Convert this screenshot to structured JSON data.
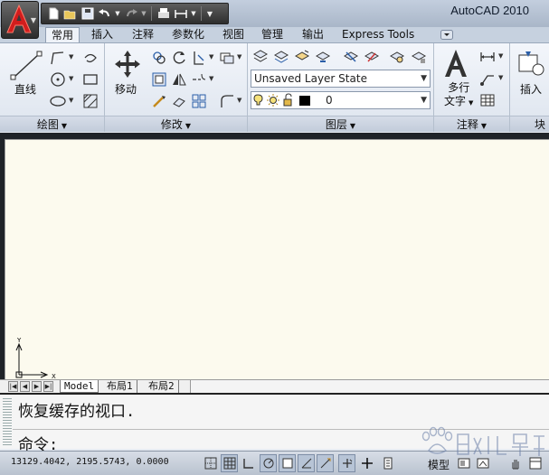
{
  "app": {
    "title": "AutoCAD 2010",
    "menu_button_icon": "autocad-logo-icon"
  },
  "quick_access_toolbar": [
    {
      "name": "qnew-icon"
    },
    {
      "name": "open-icon"
    },
    {
      "name": "save-icon"
    },
    {
      "name": "undo-icon"
    },
    {
      "name": "redo-icon"
    },
    {
      "name": "plot-icon"
    },
    {
      "name": "match-props-icon"
    }
  ],
  "ribbon": {
    "tabs": [
      "常用",
      "插入",
      "注释",
      "参数化",
      "视图",
      "管理",
      "输出",
      "Express Tools"
    ],
    "active_tab": "常用",
    "panels": {
      "draw": {
        "title": "绘图",
        "big_label": "直线"
      },
      "modify": {
        "title": "修改",
        "big_label": "移动"
      },
      "layers": {
        "title": "图层",
        "layer_state": "Unsaved Layer State",
        "current_layer": "0",
        "layer_color": "#000000"
      },
      "annotation": {
        "title": "注释",
        "big_label_line1": "多行",
        "big_label_line2": "文字"
      },
      "block": {
        "title": "块",
        "big_label": "插入"
      }
    }
  },
  "drawing": {
    "background": "#fcfaee",
    "ucs_x_label": "X",
    "ucs_y_label": "Y"
  },
  "layout_tabs": [
    "Model",
    "布局1",
    "布局2"
  ],
  "command_window": {
    "history_line": "恢复缓存的视口.",
    "prompt": "命令:"
  },
  "status_bar": {
    "coordinates": "13129.4042, 2195.5743, 0.0000",
    "model_label": "模型"
  }
}
